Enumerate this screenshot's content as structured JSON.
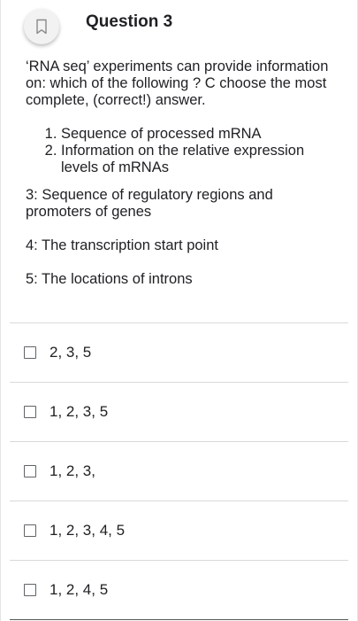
{
  "header": {
    "title": "Question 3",
    "flag_icon": "bookmark-outline-icon"
  },
  "question": {
    "intro": "‘RNA seq’ experiments can provide information on: which of the following ? C choose the most complete, (correct!) answer.",
    "numbered_items": [
      "Sequence of processed mRNA",
      "Information on the relative expression levels of mRNAs"
    ],
    "extra_items": [
      "3: Sequence of regulatory regions and promoters of genes",
      "4: The transcription start point",
      "5: The locations of introns"
    ]
  },
  "options": [
    {
      "label": "2, 3, 5",
      "checked": false
    },
    {
      "label": "1, 2, 3, 5",
      "checked": false
    },
    {
      "label": "1, 2, 3,",
      "checked": false
    },
    {
      "label": "1, 2, 3, 4, 5",
      "checked": false
    },
    {
      "label": "1, 2, 4, 5",
      "checked": false
    }
  ]
}
